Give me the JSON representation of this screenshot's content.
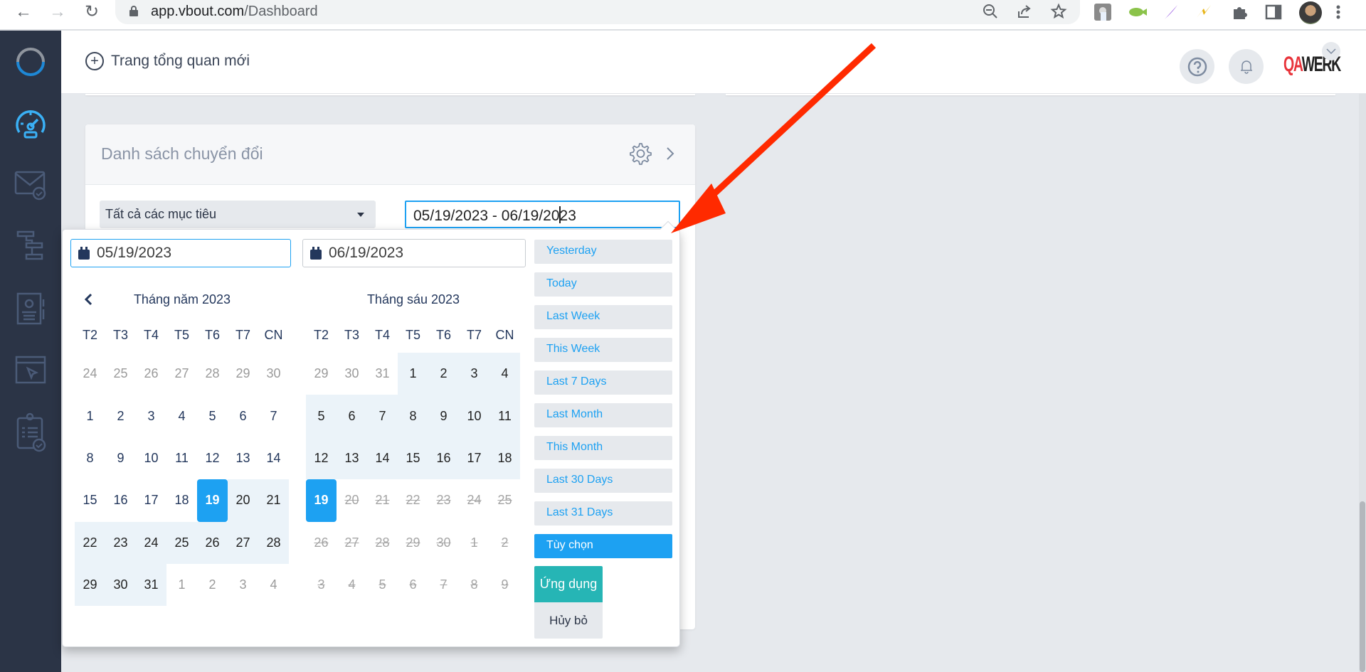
{
  "browser": {
    "url_domain": "app.vbout.com",
    "url_path": "/Dashboard",
    "nav": {
      "back": "back-icon",
      "forward": "forward-icon",
      "reload": "reload-icon"
    },
    "omnibox_icons": [
      "zoom-out-icon",
      "share-icon",
      "bookmark-star-icon"
    ],
    "extensions": [
      "touch-extension-icon",
      "video-extension-icon",
      "feather-extension-icon",
      "bolt-extension-icon",
      "puzzle-extensions-icon",
      "side-panel-icon",
      "profile-avatar",
      "menu-kebab-icon"
    ]
  },
  "sidebar": {
    "items": [
      {
        "name": "logo",
        "icon": "vbout-logo-icon"
      },
      {
        "name": "dashboard",
        "icon": "speedometer-icon",
        "active": true
      },
      {
        "name": "email-marketing",
        "icon": "envelope-check-icon"
      },
      {
        "name": "automation",
        "icon": "workflow-icon"
      },
      {
        "name": "contacts",
        "icon": "contact-card-icon"
      },
      {
        "name": "landing-pages",
        "icon": "browser-cursor-icon"
      },
      {
        "name": "tasks",
        "icon": "clipboard-check-icon"
      }
    ]
  },
  "header": {
    "new_dashboard_label": "Trang tổng quan mới",
    "help_icon": "question-circle-icon",
    "notifications_icon": "bell-icon",
    "avatar_text_red": "QA",
    "avatar_text_dark": "WERK"
  },
  "card": {
    "title": "Danh sách chuyển đổi",
    "goal_select_value": "Tất cả các mục tiêu",
    "date_range_value_before_cursor": "05/19/2023 - 06/19/20",
    "date_range_value_after_cursor": "23"
  },
  "datepicker": {
    "start_date": "05/19/2023",
    "end_date": "06/19/2023",
    "weekdays": [
      "T2",
      "T3",
      "T4",
      "T5",
      "T6",
      "T7",
      "CN"
    ],
    "left_month": {
      "title": "Tháng năm 2023",
      "rows": [
        [
          {
            "d": "24",
            "s": "off"
          },
          {
            "d": "25",
            "s": "off"
          },
          {
            "d": "26",
            "s": "off"
          },
          {
            "d": "27",
            "s": "off"
          },
          {
            "d": "28",
            "s": "off"
          },
          {
            "d": "29",
            "s": "off"
          },
          {
            "d": "30",
            "s": "off"
          }
        ],
        [
          {
            "d": "1",
            "s": ""
          },
          {
            "d": "2",
            "s": ""
          },
          {
            "d": "3",
            "s": ""
          },
          {
            "d": "4",
            "s": ""
          },
          {
            "d": "5",
            "s": ""
          },
          {
            "d": "6",
            "s": ""
          },
          {
            "d": "7",
            "s": ""
          }
        ],
        [
          {
            "d": "8",
            "s": ""
          },
          {
            "d": "9",
            "s": ""
          },
          {
            "d": "10",
            "s": ""
          },
          {
            "d": "11",
            "s": ""
          },
          {
            "d": "12",
            "s": ""
          },
          {
            "d": "13",
            "s": ""
          },
          {
            "d": "14",
            "s": ""
          }
        ],
        [
          {
            "d": "15",
            "s": ""
          },
          {
            "d": "16",
            "s": ""
          },
          {
            "d": "17",
            "s": ""
          },
          {
            "d": "18",
            "s": ""
          },
          {
            "d": "19",
            "s": "sel"
          },
          {
            "d": "20",
            "s": "inrange"
          },
          {
            "d": "21",
            "s": "inrange"
          }
        ],
        [
          {
            "d": "22",
            "s": "inrange"
          },
          {
            "d": "23",
            "s": "inrange"
          },
          {
            "d": "24",
            "s": "inrange"
          },
          {
            "d": "25",
            "s": "inrange"
          },
          {
            "d": "26",
            "s": "inrange"
          },
          {
            "d": "27",
            "s": "inrange"
          },
          {
            "d": "28",
            "s": "inrange"
          }
        ],
        [
          {
            "d": "29",
            "s": "inrange"
          },
          {
            "d": "30",
            "s": "inrange"
          },
          {
            "d": "31",
            "s": "inrange"
          },
          {
            "d": "1",
            "s": "off"
          },
          {
            "d": "2",
            "s": "off"
          },
          {
            "d": "3",
            "s": "off"
          },
          {
            "d": "4",
            "s": "off"
          }
        ]
      ]
    },
    "right_month": {
      "title": "Tháng sáu 2023",
      "rows": [
        [
          {
            "d": "29",
            "s": "off"
          },
          {
            "d": "30",
            "s": "off"
          },
          {
            "d": "31",
            "s": "off"
          },
          {
            "d": "1",
            "s": "inrange"
          },
          {
            "d": "2",
            "s": "inrange"
          },
          {
            "d": "3",
            "s": "inrange"
          },
          {
            "d": "4",
            "s": "inrange"
          }
        ],
        [
          {
            "d": "5",
            "s": "inrange"
          },
          {
            "d": "6",
            "s": "inrange"
          },
          {
            "d": "7",
            "s": "inrange"
          },
          {
            "d": "8",
            "s": "inrange"
          },
          {
            "d": "9",
            "s": "inrange"
          },
          {
            "d": "10",
            "s": "inrange"
          },
          {
            "d": "11",
            "s": "inrange"
          }
        ],
        [
          {
            "d": "12",
            "s": "inrange"
          },
          {
            "d": "13",
            "s": "inrange"
          },
          {
            "d": "14",
            "s": "inrange"
          },
          {
            "d": "15",
            "s": "inrange"
          },
          {
            "d": "16",
            "s": "inrange"
          },
          {
            "d": "17",
            "s": "inrange"
          },
          {
            "d": "18",
            "s": "inrange"
          }
        ],
        [
          {
            "d": "19",
            "s": "sel"
          },
          {
            "d": "20",
            "s": "disabled"
          },
          {
            "d": "21",
            "s": "disabled"
          },
          {
            "d": "22",
            "s": "disabled"
          },
          {
            "d": "23",
            "s": "disabled"
          },
          {
            "d": "24",
            "s": "disabled"
          },
          {
            "d": "25",
            "s": "disabled"
          }
        ],
        [
          {
            "d": "26",
            "s": "disabled"
          },
          {
            "d": "27",
            "s": "disabled"
          },
          {
            "d": "28",
            "s": "disabled"
          },
          {
            "d": "29",
            "s": "disabled"
          },
          {
            "d": "30",
            "s": "disabled"
          },
          {
            "d": "1",
            "s": "disabled"
          },
          {
            "d": "2",
            "s": "disabled"
          }
        ],
        [
          {
            "d": "3",
            "s": "disabled"
          },
          {
            "d": "4",
            "s": "disabled"
          },
          {
            "d": "5",
            "s": "disabled"
          },
          {
            "d": "6",
            "s": "disabled"
          },
          {
            "d": "7",
            "s": "disabled"
          },
          {
            "d": "8",
            "s": "disabled"
          },
          {
            "d": "9",
            "s": "disabled"
          }
        ]
      ]
    },
    "presets": [
      {
        "label": "Yesterday",
        "active": false
      },
      {
        "label": "Today",
        "active": false
      },
      {
        "label": "Last Week",
        "active": false
      },
      {
        "label": "This Week",
        "active": false
      },
      {
        "label": "Last 7 Days",
        "active": false
      },
      {
        "label": "Last Month",
        "active": false
      },
      {
        "label": "This Month",
        "active": false
      },
      {
        "label": "Last 30 Days",
        "active": false
      },
      {
        "label": "Last 31 Days",
        "active": false
      },
      {
        "label": "Tùy chọn",
        "active": true
      }
    ],
    "apply_label": "Ứng dụng",
    "cancel_label": "Hủy bỏ"
  },
  "colors": {
    "accent": "#1da1f2",
    "apply": "#26b5b5",
    "sidebar_bg": "#2b3446",
    "range_bg": "#ebf3f9",
    "annotation_arrow": "#ff2a00"
  }
}
